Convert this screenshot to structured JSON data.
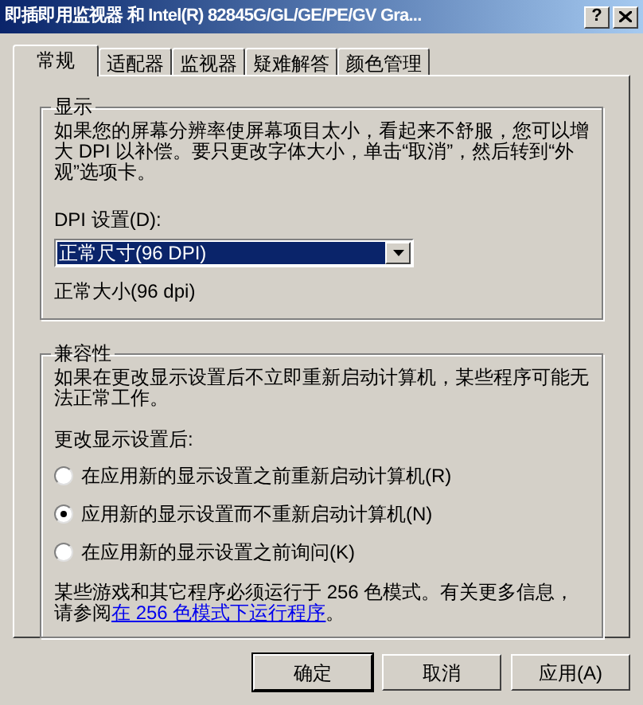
{
  "window": {
    "title": "即插即用监视器 和 Intel(R) 82845G/GL/GE/PE/GV Gra...",
    "help_button": "?"
  },
  "tabs": [
    {
      "label": "常规",
      "selected": true
    },
    {
      "label": "适配器",
      "selected": false
    },
    {
      "label": "监视器",
      "selected": false
    },
    {
      "label": "疑难解答",
      "selected": false
    },
    {
      "label": "颜色管理",
      "selected": false
    }
  ],
  "display_group": {
    "title": "显示",
    "description": "如果您的屏幕分辨率使屏幕项目太小，看起来不舒服，您可以增大 DPI 以补偿。要只更改字体大小，单击“取消”，然后转到“外观”选项卡。",
    "dpi_label": "DPI 设置(D):",
    "dpi_value": "正常尺寸(96 DPI)",
    "dpi_caption": "正常大小(96 dpi)"
  },
  "compatibility_group": {
    "title": "兼容性",
    "description": "如果在更改显示设置后不立即重新启动计算机，某些程序可能无法正常工作。",
    "options_label": "更改显示设置后:",
    "options": [
      {
        "label": "在应用新的显示设置之前重新启动计算机(R)",
        "selected": false
      },
      {
        "label": "应用新的显示设置而不重新启动计算机(N)",
        "selected": true
      },
      {
        "label": "在应用新的显示设置之前询问(K)",
        "selected": false
      }
    ],
    "note": "某些游戏和其它程序必须运行于 256 色模式。有关更多信息，请参阅",
    "note_link": "在 256 色模式下运行程序",
    "note_end": "。"
  },
  "buttons": [
    {
      "label": "确定",
      "default": true
    },
    {
      "label": "取消",
      "default": false
    },
    {
      "label": "应用(A)",
      "default": false
    }
  ]
}
